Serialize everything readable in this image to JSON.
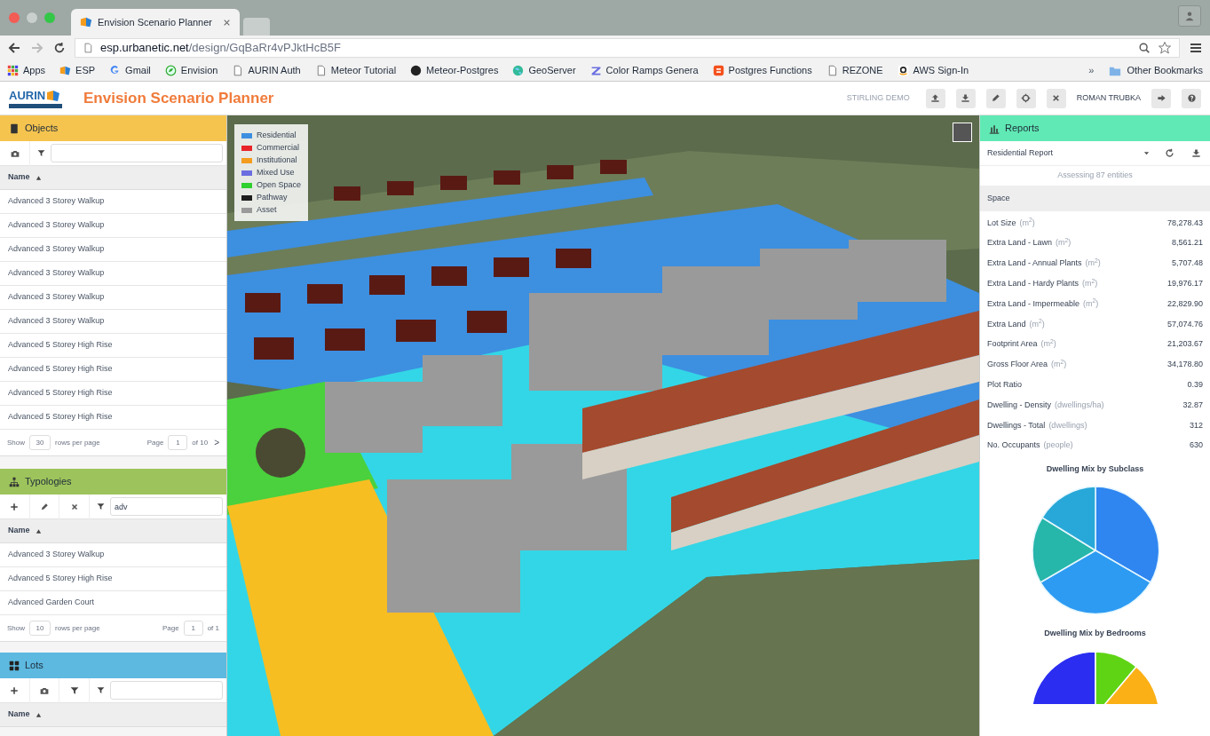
{
  "browser": {
    "tab_title": "Envision Scenario Planner",
    "url_host": "esp.urbanetic.net",
    "url_path": "/design/GqBaRr4vPJktHcB5F",
    "bookmarks": [
      {
        "kind": "apps",
        "label": "Apps"
      },
      {
        "kind": "logo",
        "label": "ESP"
      },
      {
        "kind": "google",
        "label": "Gmail"
      },
      {
        "kind": "envision",
        "label": "Envision"
      },
      {
        "kind": "page",
        "label": "AURIN Auth"
      },
      {
        "kind": "page",
        "label": "Meteor Tutorial"
      },
      {
        "kind": "github",
        "label": "Meteor-Postgres"
      },
      {
        "kind": "globe",
        "label": "GeoServer"
      },
      {
        "kind": "z",
        "label": "Color Ramps Genera"
      },
      {
        "kind": "blogger",
        "label": "Postgres Functions"
      },
      {
        "kind": "page",
        "label": "REZONE"
      },
      {
        "kind": "amazon",
        "label": "AWS Sign-In"
      }
    ],
    "more": "»",
    "other_bookmarks": "Other Bookmarks"
  },
  "app": {
    "logo_text": "AURIN",
    "title": "Envision Scenario Planner",
    "project": "STIRLING DEMO",
    "user": "ROMAN TRUBKA",
    "toolbar": [
      {
        "kind": "upload"
      },
      {
        "kind": "download"
      },
      {
        "kind": "pencil"
      },
      {
        "kind": "target"
      },
      {
        "kind": "close"
      }
    ],
    "user_buttons": [
      {
        "kind": "signout"
      },
      {
        "kind": "help"
      }
    ]
  },
  "objects": {
    "title": "Objects",
    "column": "Name",
    "rows": [
      "Advanced 3 Storey Walkup",
      "Advanced 3 Storey Walkup",
      "Advanced 3 Storey Walkup",
      "Advanced 3 Storey Walkup",
      "Advanced 3 Storey Walkup",
      "Advanced 3 Storey Walkup",
      "Advanced 5 Storey High Rise",
      "Advanced 5 Storey High Rise",
      "Advanced 5 Storey High Rise",
      "Advanced 5 Storey High Rise"
    ],
    "footer": {
      "show": "Show",
      "page_size": "30",
      "rows_per_page": "rows per page",
      "page": "Page",
      "page_number": "1",
      "of": "of 10",
      "next": ">"
    }
  },
  "typologies": {
    "title": "Typologies",
    "filter": "adv",
    "column": "Name",
    "rows": [
      "Advanced 3 Storey Walkup",
      "Advanced 5 Storey High Rise",
      "Advanced Garden Court"
    ],
    "footer": {
      "show": "Show",
      "page_size": "10",
      "rows_per_page": "rows per page",
      "page": "Page",
      "page_number": "1",
      "of": "of 1"
    }
  },
  "lots": {
    "title": "Lots",
    "column": "Name"
  },
  "legend": [
    {
      "label": "Residential",
      "color": "#3d8fe0"
    },
    {
      "label": "Commercial",
      "color": "#e8242a"
    },
    {
      "label": "Institutional",
      "color": "#f39c1e"
    },
    {
      "label": "Mixed Use",
      "color": "#6a6ee0"
    },
    {
      "label": "Open Space",
      "color": "#2ed12e"
    },
    {
      "label": "Pathway",
      "color": "#1e1e1e"
    },
    {
      "label": "Asset",
      "color": "#9a9a9a"
    }
  ],
  "reports": {
    "title": "Reports",
    "report": "Residential Report",
    "assessing": "Assessing 87 entities",
    "section": "Space",
    "metrics": [
      {
        "label": "Lot Size",
        "unit": "(m$^{2}$)",
        "value": "78,278.43"
      },
      {
        "label": "Extra Land - Lawn",
        "unit": "(m$^{2}$)",
        "value": "8,561.21"
      },
      {
        "label": "Extra Land - Annual Plants",
        "unit": "(m$^{2}$)",
        "value": "5,707.48"
      },
      {
        "label": "Extra Land - Hardy Plants",
        "unit": "(m$^{2}$)",
        "value": "19,976.17"
      },
      {
        "label": "Extra Land - Impermeable",
        "unit": "(m$^{2}$)",
        "value": "22,829.90"
      },
      {
        "label": "Extra Land",
        "unit": "(m$^{2}$)",
        "value": "57,074.76"
      },
      {
        "label": "Footprint Area",
        "unit": "(m$^{2}$)",
        "value": "21,203.67"
      },
      {
        "label": "Gross Floor Area",
        "unit": "(m$^{2}$)",
        "value": "34,178.80"
      },
      {
        "label": "Plot Ratio",
        "value": "0.39"
      },
      {
        "label": "Dwelling - Density",
        "unit": "(dwellings/ha)",
        "value": "32.87"
      },
      {
        "label": "Dwellings - Total",
        "unit": "(dwellings)",
        "value": "312"
      },
      {
        "label": "No. Occupants",
        "unit": "(people)",
        "value": "630"
      }
    ],
    "charts": [
      {
        "title": "Dwelling Mix by Subclass"
      },
      {
        "title": "Dwelling Mix by Bedrooms"
      }
    ]
  }
}
